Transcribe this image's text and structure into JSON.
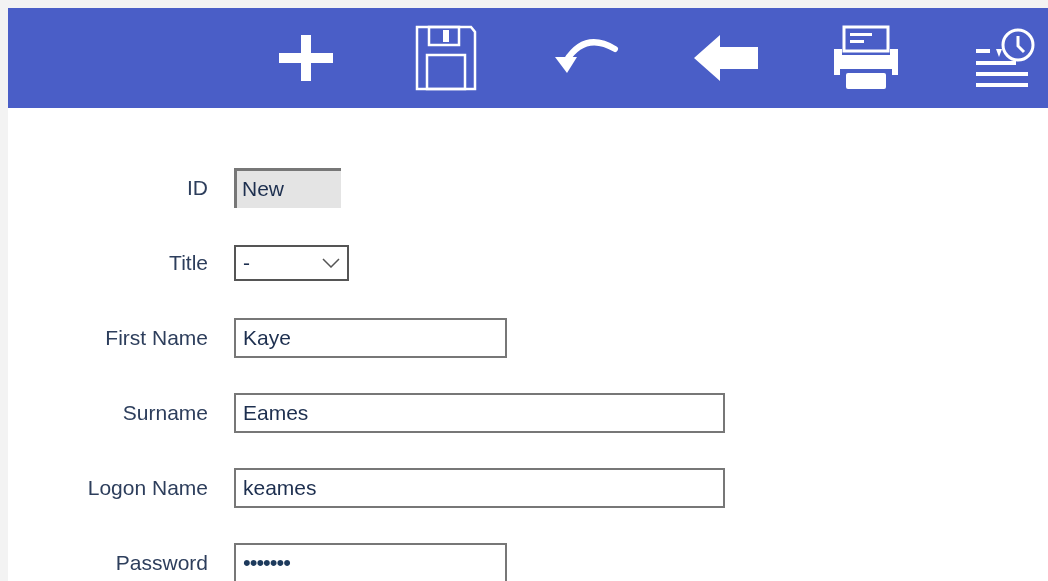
{
  "toolbar": {
    "buttons": [
      {
        "kind": "add"
      },
      {
        "kind": "save"
      },
      {
        "kind": "undo"
      },
      {
        "kind": "back"
      },
      {
        "kind": "print"
      },
      {
        "kind": "history"
      }
    ]
  },
  "form": {
    "fields": [
      {
        "label": "ID",
        "kind": "readonly",
        "value": "New"
      },
      {
        "label": "Title",
        "kind": "select",
        "value": "-"
      },
      {
        "label": "First Name",
        "kind": "text",
        "value": "Kaye"
      },
      {
        "label": "Surname",
        "kind": "text",
        "value": "Eames"
      },
      {
        "label": "Logon Name",
        "kind": "text",
        "value": "keames"
      },
      {
        "label": "Password",
        "kind": "password",
        "value": "•••••••"
      }
    ]
  }
}
